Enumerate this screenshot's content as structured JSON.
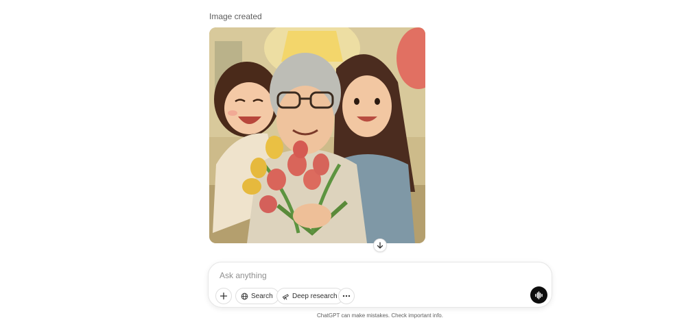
{
  "message": {
    "caption": "Image created"
  },
  "composer": {
    "placeholder": "Ask anything",
    "search_label": "Search",
    "deep_research_label": "Deep research"
  },
  "footer": {
    "disclaimer": "ChatGPT can make mistakes. Check important info."
  },
  "icons": {
    "plus": "plus-icon",
    "globe": "globe-icon",
    "telescope": "telescope-icon",
    "more": "more-icon",
    "voice": "voice-waveform-icon",
    "arrow_down": "arrow-down-icon"
  },
  "colors": {
    "voice_button": "#0d0d0d",
    "caption_text": "#5d5d5d"
  }
}
